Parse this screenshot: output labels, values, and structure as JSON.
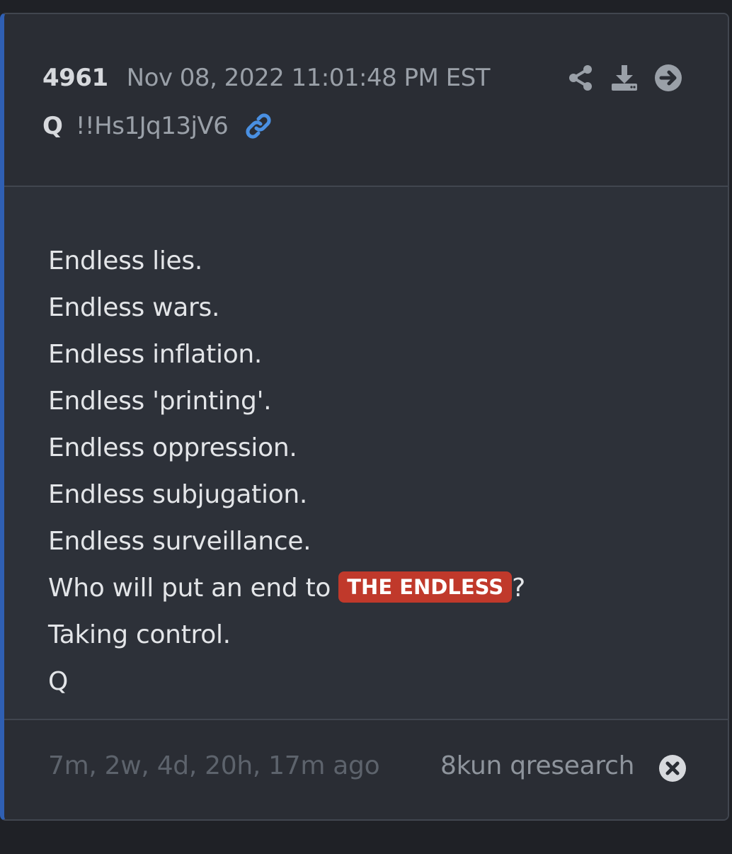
{
  "post": {
    "number": "4961",
    "date": "Nov 08, 2022 11:01:48 PM EST",
    "author": "Q",
    "tripcode": "!!Hs1Jq13jV6"
  },
  "actions": {
    "icons": [
      "share-icon",
      "download-icon",
      "arrow-right-circle-icon",
      "link-icon"
    ]
  },
  "body": {
    "lines": [
      "Endless lies.",
      "Endless wars.",
      "Endless inflation.",
      "Endless 'printing'.",
      "Endless oppression.",
      "Endless subjugation.",
      "Endless surveillance."
    ],
    "question_prefix": "Who will put an end to ",
    "question_tag": "THE ENDLESS",
    "question_suffix": "?",
    "closing_line": "Taking control.",
    "signature": "Q"
  },
  "footer": {
    "ago": "7m, 2w, 4d, 20h, 17m ago",
    "source": "8kun qresearch",
    "close_icon": "close-circle-icon"
  },
  "colors": {
    "accent_border": "#2f5fb3",
    "link": "#4a90e2",
    "tag_bg": "#c0392b",
    "card_bg": "#2d3139"
  }
}
